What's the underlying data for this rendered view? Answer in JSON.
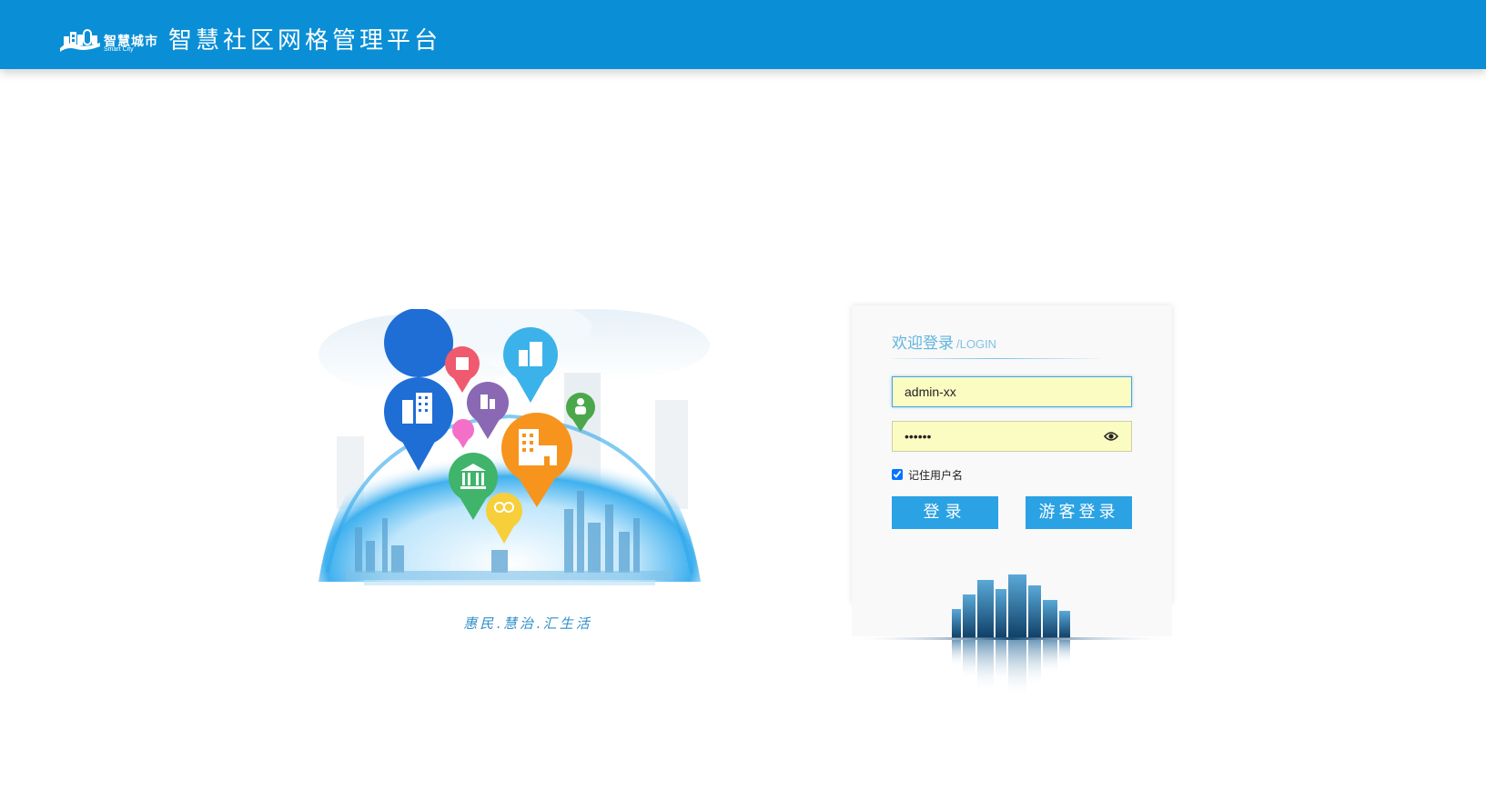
{
  "header": {
    "logo_cn": "智慧城市",
    "logo_en": "Smart City",
    "title": "智慧社区网格管理平台"
  },
  "illustration": {
    "slogan": "惠民.慧治.汇生活"
  },
  "login": {
    "title_cn": "欢迎登录",
    "title_en": "/LOGIN",
    "username_value": "admin-xx",
    "password_value": "••••••",
    "remember_label": "记住用户名",
    "remember_checked": true,
    "login_button": "登录",
    "guest_button": "游客登录"
  },
  "colors": {
    "header_bg": "#0a8fd6",
    "accent": "#2aa2e3",
    "input_bg": "#fafcc1"
  },
  "icons": {
    "logo": "city-skyline-logo-icon",
    "password_toggle": "eye-icon"
  }
}
